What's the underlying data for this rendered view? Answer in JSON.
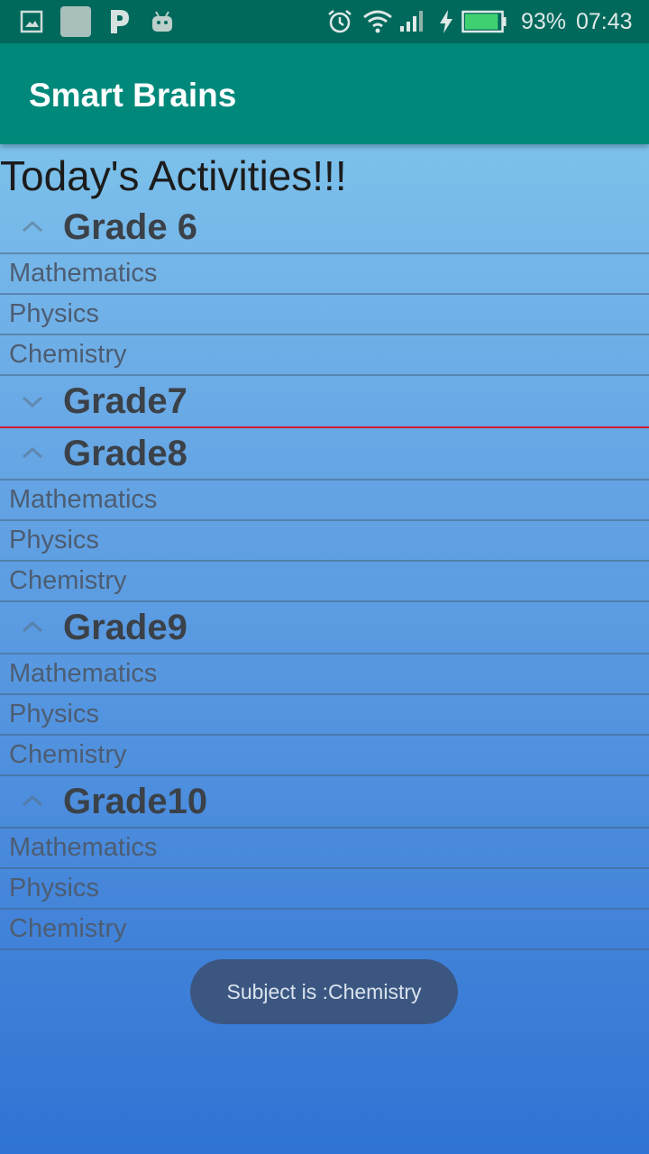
{
  "status_bar": {
    "icons_left": [
      "image-icon",
      "square-app-icon",
      "p-app-icon",
      "android-icon"
    ],
    "icons_right": [
      "alarm-icon",
      "wifi-icon",
      "signal-icon",
      "charging-icon",
      "battery-icon"
    ],
    "battery_percent": "93%",
    "battery_level": 0.93,
    "time": "07:43",
    "background": "#00695c"
  },
  "app_bar": {
    "title": "Smart Brains",
    "background": "#00897b"
  },
  "content": {
    "heading": "Today's Activities!!!",
    "groups": [
      {
        "label": "Grade 6",
        "expanded": true,
        "children": [
          "Mathematics",
          "Physics",
          "Chemistry"
        ]
      },
      {
        "label": "Grade7",
        "expanded": false,
        "children": []
      },
      {
        "label": "Grade8",
        "expanded": true,
        "children": [
          "Mathematics",
          "Physics",
          "Chemistry"
        ]
      },
      {
        "label": "Grade9",
        "expanded": true,
        "children": [
          "Mathematics",
          "Physics",
          "Chemistry"
        ]
      },
      {
        "label": "Grade10",
        "expanded": true,
        "children": [
          "Mathematics",
          "Physics",
          "Chemistry"
        ]
      }
    ]
  },
  "toast": {
    "text": "Subject is :Chemistry"
  }
}
